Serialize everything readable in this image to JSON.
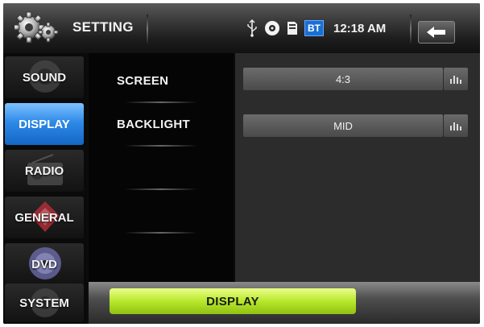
{
  "header": {
    "title": "SETTING",
    "status": {
      "usb_icon": "usb-icon",
      "disc_icon": "disc-icon",
      "sd_icon": "sd-card-icon",
      "bt_label": "BT",
      "time": "12:18 AM"
    },
    "back_icon": "back-arrow-icon"
  },
  "nav": {
    "items": [
      {
        "label": "SOUND",
        "icon": "speaker-icon",
        "active": false
      },
      {
        "label": "DISPLAY",
        "icon": "display-icon",
        "active": true
      },
      {
        "label": "RADIO",
        "icon": "radio-icon",
        "active": false
      },
      {
        "label": "GENERAL",
        "icon": "general-icon",
        "active": false
      },
      {
        "label": "DVD",
        "icon": "dvd-icon",
        "active": false
      },
      {
        "label": "SYSTEM",
        "icon": "system-icon",
        "active": false
      }
    ]
  },
  "settings": {
    "rows": [
      {
        "label": "SCREEN",
        "value": "4:3",
        "icon": "equalizer-icon"
      },
      {
        "label": "BACKLIGHT",
        "value": "MID",
        "icon": "equalizer-icon"
      }
    ]
  },
  "footer": {
    "current_section": "DISPLAY"
  },
  "colors": {
    "active_nav": "#2f8ae8",
    "footer_button": "#b8e82c",
    "panel_bg": "#2c2c2c"
  }
}
